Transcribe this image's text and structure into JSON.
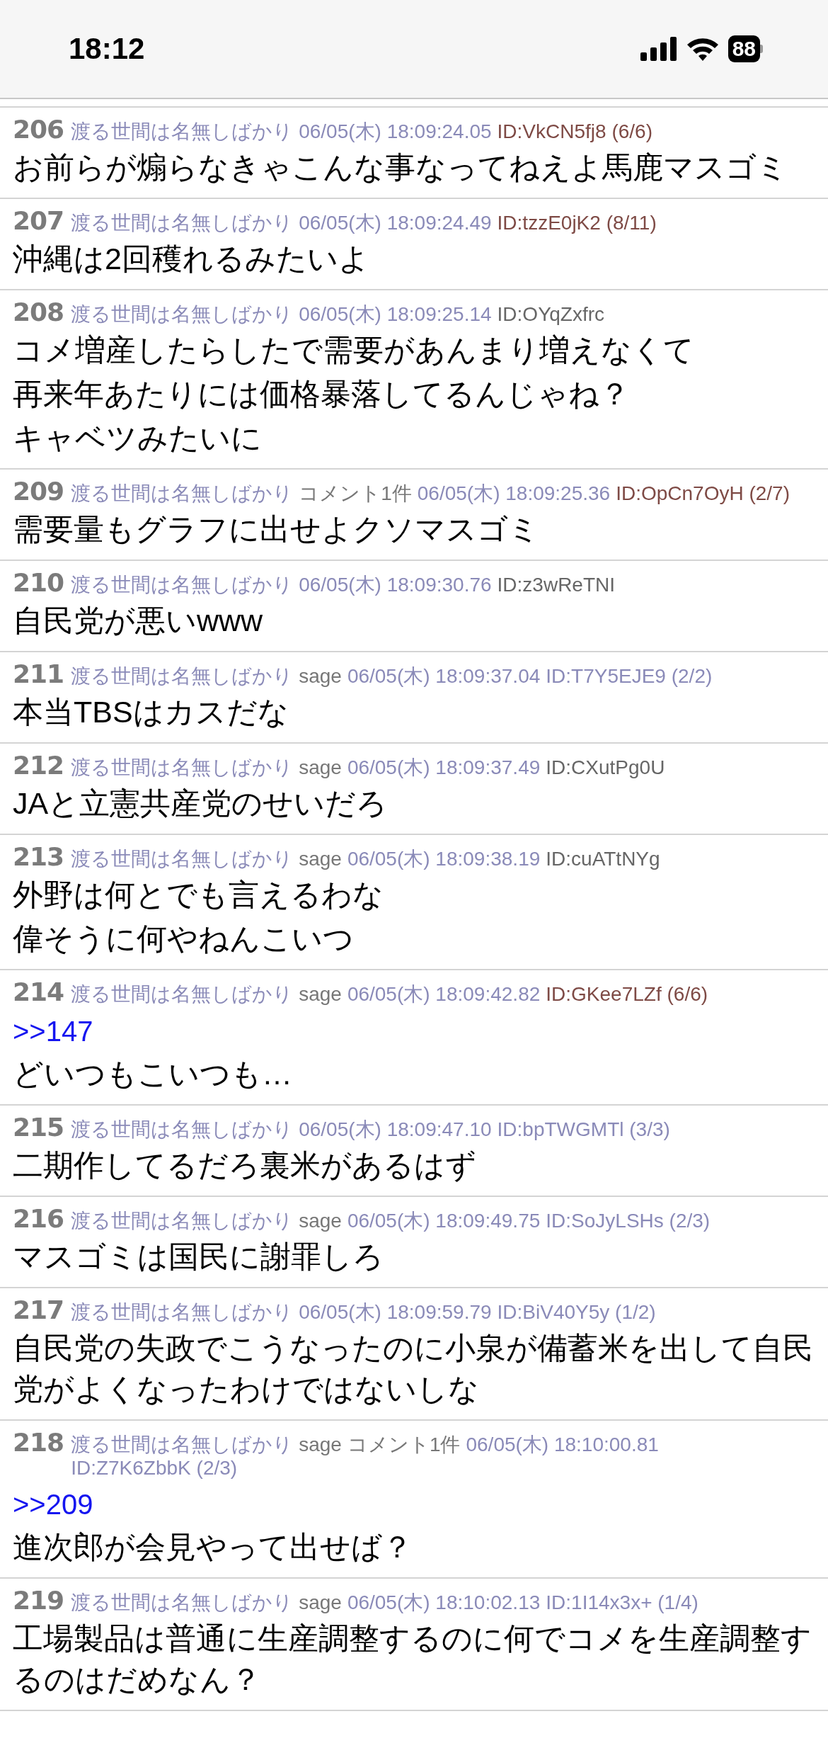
{
  "status_bar": {
    "time": "18:12",
    "battery": "88"
  },
  "posts": [
    {
      "number": "206",
      "name": "渡る世間は名無しばかり",
      "date": "06/05(木) 18:09:24.05",
      "id": "ID:VkCN5fj8 (6/6)",
      "color": "#7e4a45",
      "body": [
        "お前らが煽らなきゃこんな事なってねえよ馬鹿マスゴミ"
      ]
    },
    {
      "number": "207",
      "name": "渡る世間は名無しばかり",
      "date": "06/05(木) 18:09:24.49",
      "id": "ID:tzzE0jK2 (8/11)",
      "color": "#7e4a45",
      "body": [
        "沖縄は2回穫れるみたいよ"
      ]
    },
    {
      "number": "208",
      "name": "渡る世間は名無しばかり",
      "date": "06/05(木) 18:09:25.14",
      "id": "ID:OYqZxfrc",
      "color": "#666666",
      "body": [
        "コメ増産したらしたで需要があんまり増えなくて",
        "再来年あたりには価格暴落してるんじゃね？",
        "キャベツみたいに"
      ]
    },
    {
      "number": "209",
      "name": "渡る世間は名無しばかり",
      "comments": "コメント1件",
      "date": "06/05(木) 18:09:25.36",
      "id": "ID:OpCn7OyH (2/7)",
      "color": "#7e4a45",
      "body": [
        "需要量もグラフに出せよクソマスゴミ"
      ]
    },
    {
      "number": "210",
      "name": "渡る世間は名無しばかり",
      "date": "06/05(木) 18:09:30.76",
      "id": "ID:z3wReTNI",
      "color": "#666666",
      "body": [
        "自民党が悪いwww"
      ]
    },
    {
      "number": "211",
      "name": "渡る世間は名無しばかり",
      "mail": "sage",
      "date": "06/05(木) 18:09:37.04",
      "id": "ID:T7Y5EJE9 (2/2)",
      "color": "#8a8ab8",
      "body": [
        "本当TBSはカスだな"
      ]
    },
    {
      "number": "212",
      "name": "渡る世間は名無しばかり",
      "mail": "sage",
      "date": "06/05(木) 18:09:37.49",
      "id": "ID:CXutPg0U",
      "color": "#666666",
      "body": [
        "JAと立憲共産党のせいだろ"
      ]
    },
    {
      "number": "213",
      "name": "渡る世間は名無しばかり",
      "mail": "sage",
      "date": "06/05(木) 18:09:38.19",
      "id": "ID:cuATtNYg",
      "color": "#666666",
      "body": [
        "外野は何とでも言えるわな",
        "偉そうに何やねんこいつ"
      ]
    },
    {
      "number": "214",
      "name": "渡る世間は名無しばかり",
      "mail": "sage",
      "date": "06/05(木) 18:09:42.82",
      "id": "ID:GKee7LZf (6/6)",
      "color": "#7e4a45",
      "anchor": ">>147",
      "body": [
        "どいつもこいつも…"
      ]
    },
    {
      "number": "215",
      "name": "渡る世間は名無しばかり",
      "date": "06/05(木) 18:09:47.10",
      "id": "ID:bpTWGMTl (3/3)",
      "color": "#8a8ab8",
      "body": [
        "二期作してるだろ裏米があるはず"
      ]
    },
    {
      "number": "216",
      "name": "渡る世間は名無しばかり",
      "mail": "sage",
      "date": "06/05(木) 18:09:49.75",
      "id": "ID:SoJyLSHs (2/3)",
      "color": "#8a8ab8",
      "body": [
        "マスゴミは国民に謝罪しろ"
      ]
    },
    {
      "number": "217",
      "name": "渡る世間は名無しばかり",
      "date": "06/05(木) 18:09:59.79",
      "id": "ID:BiV40Y5y (1/2)",
      "color": "#8a8ab8",
      "body": [
        "自民党の失政でこうなったのに小泉が備蓄米を出して自民党がよくなったわけではないしな"
      ]
    },
    {
      "number": "218",
      "name": "渡る世間は名無しばかり",
      "mail": "sage",
      "comments": "コメント1件",
      "date": "06/05(木) 18:10:00.81",
      "id": "ID:Z7K6ZbbK (2/3)",
      "color": "#8a8ab8",
      "anchor": ">>209",
      "body": [
        "進次郎が会見やって出せば？"
      ]
    },
    {
      "number": "219",
      "name": "渡る世間は名無しばかり",
      "mail": "sage",
      "date": "06/05(木) 18:10:02.13",
      "id": "ID:1I14x3x+ (1/4)",
      "color": "#8a8ab8",
      "body": [
        "工場製品は普通に生産調整するのに何でコメを生産調整するのはだめなん？"
      ]
    }
  ]
}
